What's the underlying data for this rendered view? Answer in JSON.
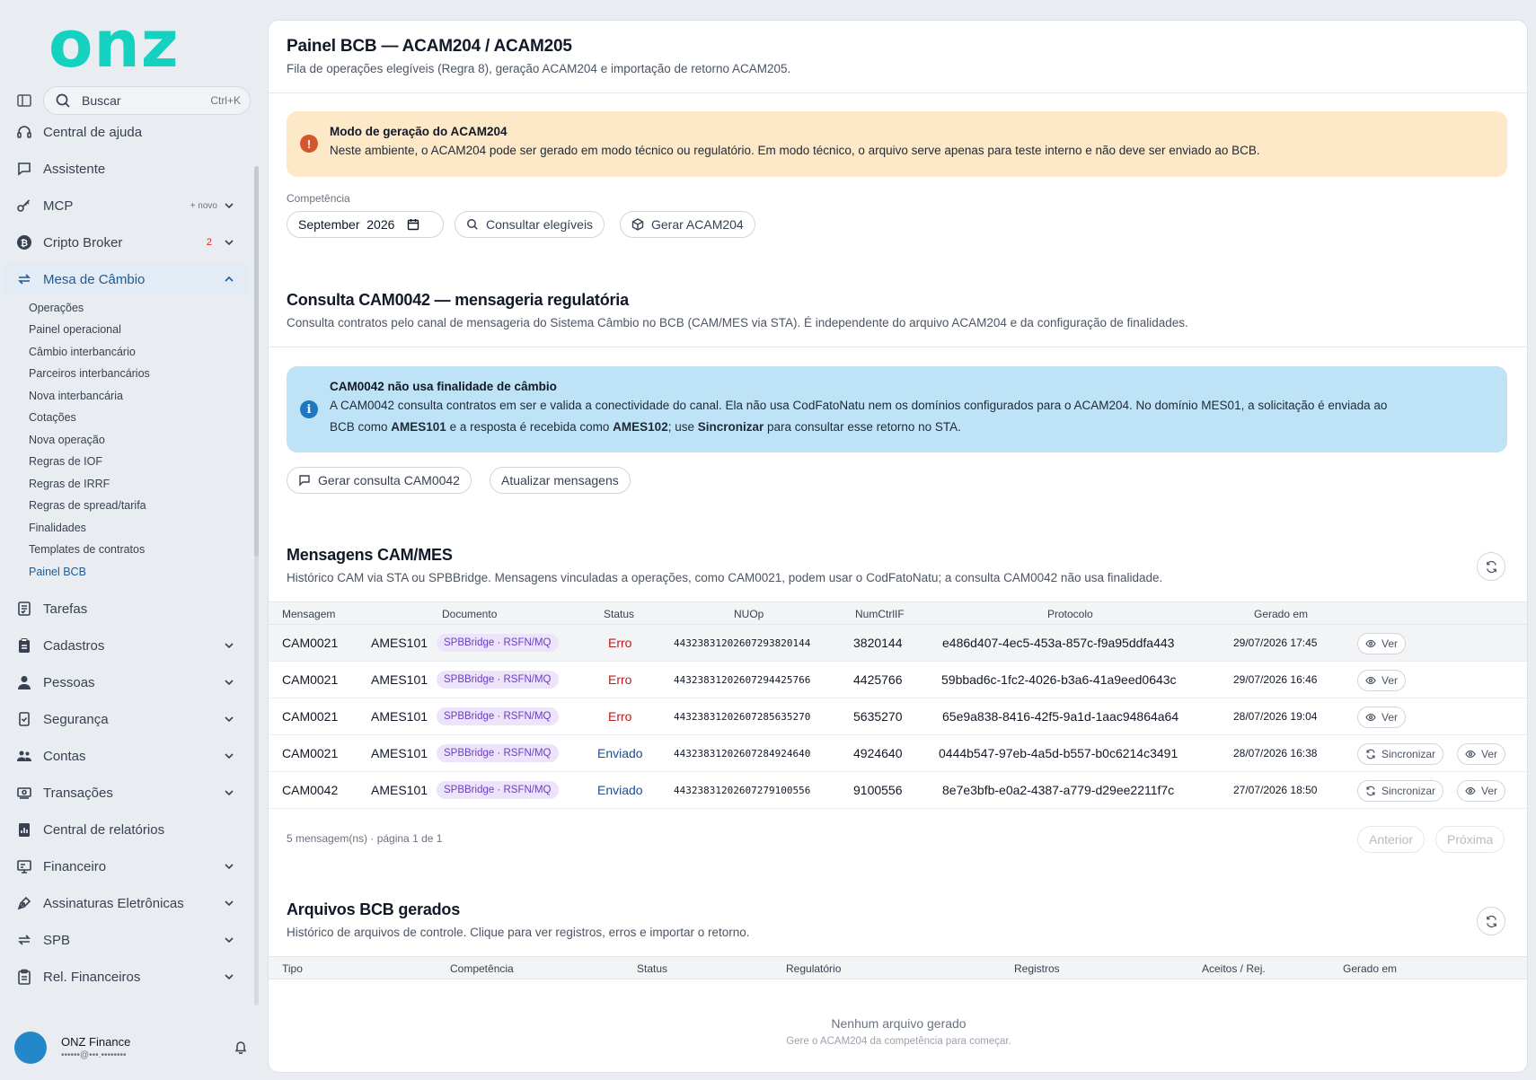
{
  "brand": {
    "logo_text": "onz",
    "accent": "#15d1c0"
  },
  "search": {
    "label": "Buscar",
    "shortcut": "Ctrl+K"
  },
  "sidebar": {
    "items": [
      {
        "label": "Central de ajuda",
        "icon": "headset-icon"
      },
      {
        "label": "Assistente",
        "icon": "chat-icon"
      },
      {
        "label": "MCP",
        "icon": "key-icon",
        "badge": "+ novo"
      },
      {
        "label": "Cripto Broker",
        "icon": "bitcoin-icon",
        "badge": "2"
      },
      {
        "label": "Mesa de Câmbio",
        "icon": "exchange-icon"
      },
      {
        "label": "Tarefas",
        "icon": "tasks-icon"
      },
      {
        "label": "Cadastros",
        "icon": "clipboard-icon"
      },
      {
        "label": "Pessoas",
        "icon": "person-icon"
      },
      {
        "label": "Segurança",
        "icon": "shield-check-icon"
      },
      {
        "label": "Contas",
        "icon": "users-icon"
      },
      {
        "label": "Transações",
        "icon": "money-icon"
      },
      {
        "label": "Central de relatórios",
        "icon": "report-icon"
      },
      {
        "label": "Financeiro",
        "icon": "monitor-icon"
      },
      {
        "label": "Assinaturas Eletrônicas",
        "icon": "pen-icon"
      },
      {
        "label": "SPB",
        "icon": "transfer-icon"
      },
      {
        "label": "Rel. Financeiros",
        "icon": "clipboard-list-icon"
      }
    ],
    "subitems": [
      "Operações",
      "Painel operacional",
      "Câmbio interbancário",
      "Parceiros interbancários",
      "Nova interbancária",
      "Cotações",
      "Nova operação",
      "Regras de IOF",
      "Regras de IRRF",
      "Regras de spread/tarifa",
      "Finalidades",
      "Templates de contratos",
      "Painel BCB"
    ]
  },
  "user": {
    "name": "ONZ Finance",
    "email": "••••••@•••.••••••••"
  },
  "page": {
    "title": "Painel BCB — ACAM204 / ACAM205",
    "subtitle": "Fila de operações elegíveis (Regra 8), geração ACAM204 e importação de retorno ACAM205."
  },
  "warn_alert": {
    "title": "Modo de geração do ACAM204",
    "text": "Neste ambiente, o ACAM204 pode ser gerado em modo técnico ou regulatório. Em modo técnico, o arquivo serve apenas para teste interno e não deve ser enviado ao BCB."
  },
  "competencia": {
    "label": "Competência",
    "value": "September  2026"
  },
  "actions": {
    "consultar": "Consultar elegíveis",
    "gerar": "Gerar ACAM204"
  },
  "cam0042": {
    "title": "Consulta CAM0042 — mensageria regulatória",
    "subtitle": "Consulta contratos pelo canal de mensageria do Sistema Câmbio no BCB (CAM/MES via STA). É independente do arquivo ACAM204 e da configuração de finalidades.",
    "info_title": "CAM0042 não usa finalidade de câmbio",
    "info_1": "A CAM0042 consulta contratos em ser e valida a conectividade do canal. Ela não usa CodFatoNatu nem os domínios configurados para o ACAM204. No domínio MES01, a solicitação é enviada ao",
    "info_2a": "BCB como ",
    "info_2b": "AMES101",
    "info_2c": " e a resposta é recebida como ",
    "info_2d": "AMES102",
    "info_2e": "; use ",
    "info_2f": "Sincronizar",
    "info_2g": " para consultar esse retorno no STA.",
    "btn_gerar": "Gerar consulta CAM0042",
    "btn_atualizar": "Atualizar mensagens"
  },
  "messages": {
    "title": "Mensagens CAM/MES",
    "subtitle": "Histórico CAM via STA ou SPBBridge. Mensagens vinculadas a operações, como CAM0021, podem usar o CodFatoNatu; a consulta CAM0042 não usa finalidade.",
    "columns": [
      "Mensagem",
      "Documento",
      "Status",
      "NUOp",
      "NumCtrlIF",
      "Protocolo",
      "Gerado em"
    ],
    "rows": [
      {
        "msg": "CAM0021",
        "doc": "AMES101",
        "chip": "SPBBridge · RSFN/MQ",
        "status": "Erro",
        "nuop": "44323831202607293820144",
        "ctrl": "3820144",
        "proto": "e486d407-4ec5-453a-857c-f9a95ddfa443",
        "date": "29/07/2026 17:45"
      },
      {
        "msg": "CAM0021",
        "doc": "AMES101",
        "chip": "SPBBridge · RSFN/MQ",
        "status": "Erro",
        "nuop": "44323831202607294425766",
        "ctrl": "4425766",
        "proto": "59bbad6c-1fc2-4026-b3a6-41a9eed0643c",
        "date": "29/07/2026 16:46"
      },
      {
        "msg": "CAM0021",
        "doc": "AMES101",
        "chip": "SPBBridge · RSFN/MQ",
        "status": "Erro",
        "nuop": "44323831202607285635270",
        "ctrl": "5635270",
        "proto": "65e9a838-8416-42f5-9a1d-1aac94864a64",
        "date": "28/07/2026 19:04"
      },
      {
        "msg": "CAM0021",
        "doc": "AMES101",
        "chip": "SPBBridge · RSFN/MQ",
        "status": "Enviado",
        "nuop": "44323831202607284924640",
        "ctrl": "4924640",
        "proto": "0444b547-97eb-4a5d-b557-b0c6214c3491",
        "date": "28/07/2026 16:38"
      },
      {
        "msg": "CAM0042",
        "doc": "AMES101",
        "chip": "SPBBridge · RSFN/MQ",
        "status": "Enviado",
        "nuop": "44323831202607279100556",
        "ctrl": "9100556",
        "proto": "8e7e3bfb-e0a2-4387-a779-d29ee2211f7c",
        "date": "27/07/2026 18:50"
      }
    ],
    "btn_ver": "Ver",
    "btn_sync": "Sincronizar",
    "footer": "5 mensagem(ns) · página 1 de 1",
    "prev": "Anterior",
    "next": "Próxima"
  },
  "files": {
    "title": "Arquivos BCB gerados",
    "subtitle": "Histórico de arquivos de controle. Clique para ver registros, erros e importar o retorno.",
    "columns": [
      "Tipo",
      "Competência",
      "Status",
      "Regulatório",
      "Registros",
      "Aceitos / Rej.",
      "Gerado em"
    ],
    "empty_title": "Nenhum arquivo gerado",
    "empty_sub": "Gere o ACAM204 da competência para começar."
  }
}
